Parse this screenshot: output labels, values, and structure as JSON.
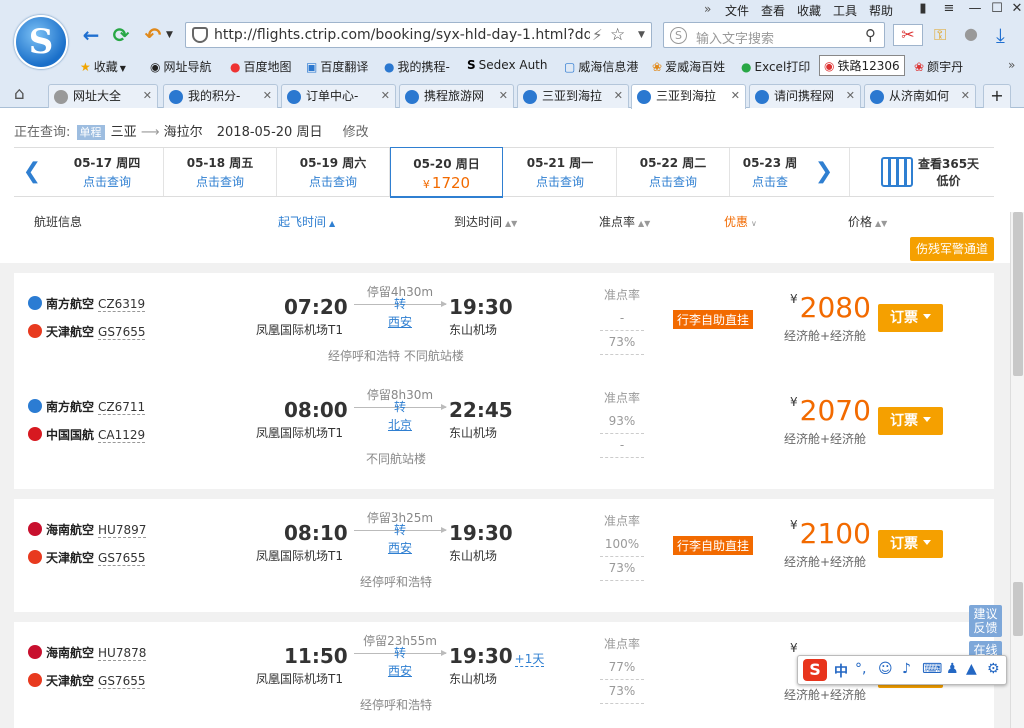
{
  "browser": {
    "url": "http://flights.ctrip.com/booking/syx-hld-day-1.html?ddate1=2018-05-20",
    "search_placeholder": "输入文字搜索",
    "menu": [
      "文件",
      "查看",
      "收藏",
      "工具",
      "帮助"
    ],
    "bookmarks": [
      "收藏",
      "网址导航",
      "百度地图",
      "百度翻译",
      "我的携程-",
      "Sedex Auth",
      "威海信息港",
      "爱威海百姓",
      "Excel打印",
      "铁路12306",
      "颜宇丹"
    ],
    "tabs": [
      "网址大全",
      "我的积分-",
      "订单中心-",
      "携程旅游网",
      "三亚到海拉",
      "三亚到海拉",
      "请问携程网",
      "从济南如何"
    ],
    "active_tab": 5
  },
  "query": {
    "label": "正在查询:",
    "trip_type": "单程",
    "from": "三亚",
    "to": "海拉尔",
    "date": "2018-05-20 周日",
    "edit": "修改"
  },
  "dates": [
    {
      "date": "05-17 周四",
      "sub": "点击查询"
    },
    {
      "date": "05-18 周五",
      "sub": "点击查询"
    },
    {
      "date": "05-19 周六",
      "sub": "点击查询"
    },
    {
      "date": "05-20 周日",
      "sub": "1720",
      "currency": "¥"
    },
    {
      "date": "05-21 周一",
      "sub": "点击查询"
    },
    {
      "date": "05-22 周二",
      "sub": "点击查询"
    },
    {
      "date": "05-23 周",
      "sub": "点击查"
    }
  ],
  "view365": {
    "line1": "查看365天",
    "line2": "低价"
  },
  "headers": {
    "flight": "航班信息",
    "depart": "起飞时间",
    "arrive": "到达时间",
    "punctuality": "准点率",
    "discount": "优惠",
    "price": "价格"
  },
  "disabled_channel": "伤残军警通道",
  "flights": [
    {
      "seg1": {
        "airline": "南方航空",
        "code": "CZ6319",
        "color": "#2b7cd3"
      },
      "seg2": {
        "airline": "天津航空",
        "code": "GS7655",
        "color": "#e83a1f"
      },
      "dep_time": "07:20",
      "dep_airport": "凤凰国际机场T1",
      "stop_info": "停留4h30m",
      "transfer": "转",
      "transfer_city": "西安",
      "arr_time": "19:30",
      "arr_airport": "东山机场",
      "plus_day": "",
      "note": "经停呼和浩特 不同航站楼",
      "punct_label": "准点率",
      "punct1": "-",
      "punct2": "73%",
      "badge": "行李自助直挂",
      "currency": "¥",
      "price": "2080",
      "cabin": "经济舱+经济舱",
      "book": "订票"
    },
    {
      "seg1": {
        "airline": "南方航空",
        "code": "CZ6711",
        "color": "#2b7cd3"
      },
      "seg2": {
        "airline": "中国国航",
        "code": "CA1129",
        "color": "#d71920"
      },
      "dep_time": "08:00",
      "dep_airport": "凤凰国际机场T1",
      "stop_info": "停留8h30m",
      "transfer": "转",
      "transfer_city": "北京",
      "arr_time": "22:45",
      "arr_airport": "东山机场",
      "plus_day": "",
      "note": "不同航站楼",
      "punct_label": "准点率",
      "punct1": "93%",
      "punct2": "-",
      "badge": "",
      "currency": "¥",
      "price": "2070",
      "cabin": "经济舱+经济舱",
      "book": "订票"
    },
    {
      "seg1": {
        "airline": "海南航空",
        "code": "HU7897",
        "color": "#c8102e"
      },
      "seg2": {
        "airline": "天津航空",
        "code": "GS7655",
        "color": "#e83a1f"
      },
      "dep_time": "08:10",
      "dep_airport": "凤凰国际机场T1",
      "stop_info": "停留3h25m",
      "transfer": "转",
      "transfer_city": "西安",
      "arr_time": "19:30",
      "arr_airport": "东山机场",
      "plus_day": "",
      "note": "经停呼和浩特",
      "punct_label": "准点率",
      "punct1": "100%",
      "punct2": "73%",
      "badge": "行李自助直挂",
      "currency": "¥",
      "price": "2100",
      "cabin": "经济舱+经济舱",
      "book": "订票"
    },
    {
      "seg1": {
        "airline": "海南航空",
        "code": "HU7878",
        "color": "#c8102e"
      },
      "seg2": {
        "airline": "天津航空",
        "code": "GS7655",
        "color": "#e83a1f"
      },
      "dep_time": "11:50",
      "dep_airport": "凤凰国际机场T1",
      "stop_info": "停留23h55m",
      "transfer": "转",
      "transfer_city": "西安",
      "arr_time": "19:30",
      "arr_airport": "东山机场",
      "plus_day": "+1天",
      "note": "经停呼和浩特",
      "punct_label": "准点率",
      "punct1": "77%",
      "punct2": "73%",
      "badge": "",
      "currency": "¥",
      "price": "",
      "cabin": "经济舱+经济舱",
      "book": "订票"
    }
  ],
  "side": {
    "feedback": "建议反馈",
    "online": "在线"
  },
  "ime": {
    "logo": "S",
    "lang": "中"
  }
}
